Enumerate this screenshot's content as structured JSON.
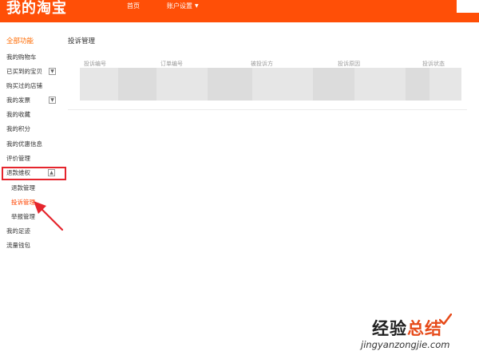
{
  "header": {
    "logo": "我的淘宝",
    "nav_home": "首页",
    "nav_account": "账户设置",
    "caret": "▼"
  },
  "sidebar": {
    "title": "全部功能",
    "items": [
      {
        "label": "我的购物车"
      },
      {
        "label": "已买到的宝贝",
        "expand": "▼"
      },
      {
        "label": "购买过的店铺"
      },
      {
        "label": "我的发票",
        "expand": "▼"
      },
      {
        "label": "我的收藏"
      },
      {
        "label": "我的积分"
      },
      {
        "label": "我的优惠信息"
      },
      {
        "label": "评价管理"
      },
      {
        "label": "退款维权",
        "expand": "▲"
      },
      {
        "label": "退款管理"
      },
      {
        "label": "投诉管理"
      },
      {
        "label": "举报管理"
      },
      {
        "label": "我的足迹"
      },
      {
        "label": "流量钱包"
      }
    ]
  },
  "main": {
    "title": "投诉管理",
    "table_headers": [
      "投诉编号",
      "订单编号",
      "被投诉方",
      "投诉原因",
      "投诉状态"
    ]
  },
  "watermark": {
    "main_a": "经验",
    "main_b": "总结",
    "url": "jingyanzongjie.com"
  },
  "colors": {
    "header_bg": "#ff4f07",
    "accent": "#ff6a00",
    "highlight": "#e5252d"
  }
}
